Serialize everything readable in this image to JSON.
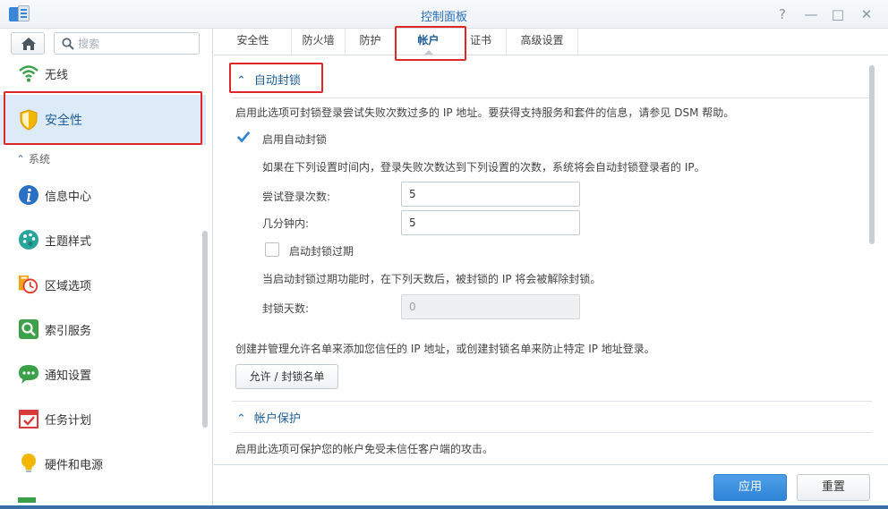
{
  "window": {
    "title": "控制面板",
    "help": "?",
    "minimize": "—",
    "maximize": "□",
    "close": "✕"
  },
  "search": {
    "placeholder": "搜索"
  },
  "sidebar": {
    "top_item": "无线",
    "active_item": "安全性",
    "section": "系统",
    "items": [
      {
        "label": "信息中心",
        "icon": "info-icon"
      },
      {
        "label": "主题样式",
        "icon": "palette-icon"
      },
      {
        "label": "区域选项",
        "icon": "calendar-clock-icon"
      },
      {
        "label": "索引服务",
        "icon": "magnifier-icon"
      },
      {
        "label": "通知设置",
        "icon": "chat-bubble-icon"
      },
      {
        "label": "任务计划",
        "icon": "calendar-check-icon"
      },
      {
        "label": "硬件和电源",
        "icon": "bulb-icon"
      }
    ]
  },
  "tabs": [
    "安全性",
    "防火墙",
    "防护",
    "帐户",
    "证书",
    "高级设置"
  ],
  "active_tab": "帐户",
  "autoblock": {
    "title": "自动封锁",
    "description": "启用此选项可封锁登录尝试失败次数过多的 IP 地址。要获得支持服务和套件的信息，请参见 DSM 帮助。",
    "enable_label": "启用自动封锁",
    "enabled": true,
    "rule_text": "如果在下列设置时间内，登录失败次数达到下列设置的次数，系统将会自动封锁登录者的 IP。",
    "attempts_label": "尝试登录次数:",
    "attempts_value": "5",
    "minutes_label": "几分钟内:",
    "minutes_value": "5",
    "expire_label": "启动封锁过期",
    "expire_enabled": false,
    "expire_text": "当启动封锁过期功能时，在下列天数后，被封锁的 IP 将会被解除封锁。",
    "days_label": "封锁天数:",
    "days_value": "0",
    "list_text": "创建并管理允许名单来添加您信任的 IP 地址，或创建封锁名单来防止特定 IP 地址登录。",
    "list_button": "允许 / 封锁名单"
  },
  "account_protection": {
    "title": "帐户保护",
    "description": "启用此选项可保护您的帐户免受未信任客户端的攻击。"
  },
  "footer": {
    "apply": "应用",
    "reset": "重置"
  },
  "colors": {
    "accent": "#2f84d6",
    "highlight": "#e02727",
    "active_bg": "#dcebf7"
  }
}
